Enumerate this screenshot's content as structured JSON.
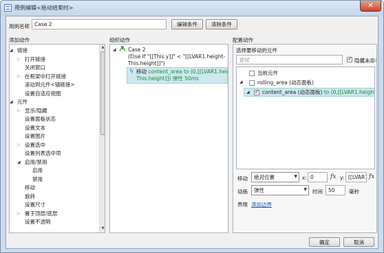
{
  "window": {
    "title": "用例编辑<拖动结束时>",
    "close_glyph": "✕"
  },
  "case_name": {
    "label": "用例名称",
    "value": "Case 2",
    "edit_button": "编辑条件",
    "clear_button": "清除条件"
  },
  "add_action": {
    "header": "添加动作",
    "items": [
      {
        "label": "链接",
        "level": 0,
        "toggle": "open"
      },
      {
        "label": "打开链接",
        "level": 1,
        "toggle": "closed"
      },
      {
        "label": "关闭窗口",
        "level": 1,
        "toggle": ""
      },
      {
        "label": "在框架中打开链接",
        "level": 1,
        "toggle": "closed"
      },
      {
        "label": "滚动到元件<锚链接>",
        "level": 1,
        "toggle": ""
      },
      {
        "label": "设置自适应视图",
        "level": 1,
        "toggle": ""
      },
      {
        "label": "元件",
        "level": 0,
        "toggle": "open"
      },
      {
        "label": "显示/隐藏",
        "level": 1,
        "toggle": "closed"
      },
      {
        "label": "设置面板状态",
        "level": 1,
        "toggle": ""
      },
      {
        "label": "设置文本",
        "level": 1,
        "toggle": ""
      },
      {
        "label": "设置图片",
        "level": 1,
        "toggle": ""
      },
      {
        "label": "设置选中",
        "level": 1,
        "toggle": "closed"
      },
      {
        "label": "设置列表选中项",
        "level": 1,
        "toggle": ""
      },
      {
        "label": "启用/禁用",
        "level": 1,
        "toggle": "open"
      },
      {
        "label": "启用",
        "level": 2,
        "toggle": ""
      },
      {
        "label": "禁用",
        "level": 2,
        "toggle": ""
      },
      {
        "label": "移动",
        "level": 1,
        "toggle": ""
      },
      {
        "label": "旋转",
        "level": 1,
        "toggle": ""
      },
      {
        "label": "设置尺寸",
        "level": 1,
        "toggle": ""
      },
      {
        "label": "置于顶层/底层",
        "level": 1,
        "toggle": "closed"
      },
      {
        "label": "设置不透明",
        "level": 1,
        "toggle": ""
      }
    ]
  },
  "organize_action": {
    "header": "组织动作",
    "case_title": "Case 2",
    "condition_line1": "(Else If \"[[This.y]]\" < \"[[LVAR1.height-",
    "condition_line2": "This.height]]\")",
    "action_prefix": "移动",
    "action_line1": "content_area to (0,[[LVAR1.height-",
    "action_line2": "This.height]]) 弹性 50ms"
  },
  "configure_action": {
    "header": "配置动作",
    "subheader": "选择要移动的元件",
    "search_placeholder": "查找",
    "hide_unnamed_label": "隐藏未命名的元件",
    "hide_unnamed_checked": true,
    "tree": [
      {
        "label": "当前元件",
        "checked": false
      },
      {
        "label": "rolling_area (动态面板)",
        "checked": false
      },
      {
        "label": "content_area (动态面板)",
        "suffix": "to (0,[[LVAR1.height-This.height]",
        "checked": true
      }
    ],
    "move_label": "移动",
    "move_mode": "绝对位置",
    "x_label": "x:",
    "x_value": "0",
    "y_label": "y:",
    "y_value": "[[LVAR1.",
    "fx_label": "fx",
    "anim_label": "动画",
    "anim_value": "弹性",
    "time_label": "时间",
    "time_value": "50",
    "ms_label": "毫秒",
    "bounds_label": "界限",
    "add_bounds_link": "添加边界"
  },
  "footer": {
    "ok_button": "确定",
    "cancel_button": "取消"
  }
}
